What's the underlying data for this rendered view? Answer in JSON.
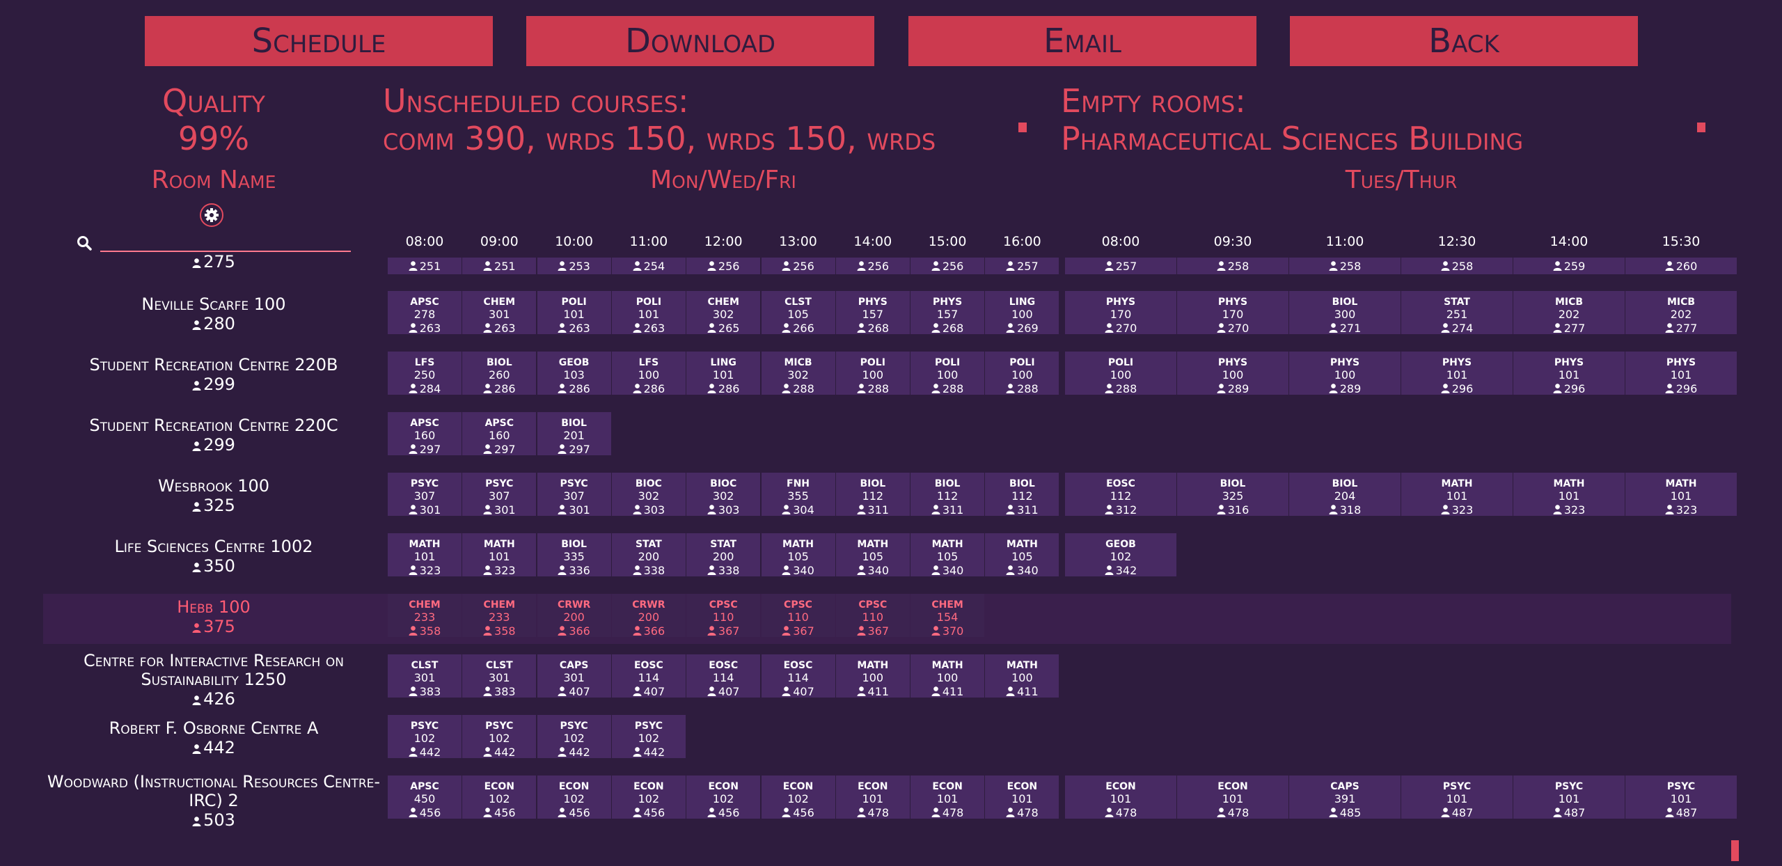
{
  "toolbar": {
    "schedule": "Schedule",
    "download": "Download",
    "email": "Email",
    "back": "Back"
  },
  "quality": {
    "title": "Quality",
    "value": "99%"
  },
  "room_name_label": "Room Name",
  "unscheduled": {
    "title": "Unscheduled courses:",
    "list": "comm 390, wrds 150, wrds 150, wrds"
  },
  "empty_rooms": {
    "title": "Empty rooms:",
    "list": "Pharmaceutical Sciences Building"
  },
  "mwf": {
    "label": "Mon/Wed/Fri",
    "times": [
      "08:00",
      "09:00",
      "10:00",
      "11:00",
      "12:00",
      "13:00",
      "14:00",
      "15:00",
      "16:00"
    ]
  },
  "tt": {
    "label": "Tues/Thur",
    "times": [
      "08:00",
      "09:30",
      "11:00",
      "12:30",
      "14:00",
      "15:30"
    ]
  },
  "search": {
    "placeholder": "",
    "value": ""
  },
  "colors": {
    "accent": "#e24a5e",
    "button": "#cc3a4f",
    "background": "#2e1c3e",
    "cell": "#482a63"
  },
  "icons": {
    "settings": "gear-icon",
    "search": "search-icon",
    "capacity": "person-icon"
  },
  "partial_row": {
    "capacity": "275",
    "mwf": [
      "251",
      "251",
      "253",
      "254",
      "256",
      "256",
      "256",
      "256",
      "257"
    ],
    "tt": [
      "257",
      "258",
      "258",
      "258",
      "259",
      "260"
    ]
  },
  "rooms": [
    {
      "name": "Neville Scarfe 100",
      "capacity": "280",
      "selected": false,
      "mwf": [
        [
          "APSC",
          "278",
          "263"
        ],
        [
          "CHEM",
          "301",
          "263"
        ],
        [
          "POLI",
          "101",
          "263"
        ],
        [
          "POLI",
          "101",
          "263"
        ],
        [
          "CHEM",
          "302",
          "265"
        ],
        [
          "CLST",
          "105",
          "266"
        ],
        [
          "PHYS",
          "157",
          "268"
        ],
        [
          "PHYS",
          "157",
          "268"
        ],
        [
          "LING",
          "100",
          "269"
        ]
      ],
      "tt": [
        [
          "PHYS",
          "170",
          "270"
        ],
        [
          "PHYS",
          "170",
          "270"
        ],
        [
          "BIOL",
          "300",
          "271"
        ],
        [
          "STAT",
          "251",
          "274"
        ],
        [
          "MICB",
          "202",
          "277"
        ],
        [
          "MICB",
          "202",
          "277"
        ]
      ]
    },
    {
      "name": "Student Recreation Centre 220B",
      "capacity": "299",
      "selected": false,
      "mwf": [
        [
          "LFS",
          "250",
          "284"
        ],
        [
          "BIOL",
          "260",
          "286"
        ],
        [
          "GEOB",
          "103",
          "286"
        ],
        [
          "LFS",
          "100",
          "286"
        ],
        [
          "LING",
          "101",
          "286"
        ],
        [
          "MICB",
          "302",
          "288"
        ],
        [
          "POLI",
          "100",
          "288"
        ],
        [
          "POLI",
          "100",
          "288"
        ],
        [
          "POLI",
          "100",
          "288"
        ]
      ],
      "tt": [
        [
          "POLI",
          "100",
          "288"
        ],
        [
          "PHYS",
          "100",
          "289"
        ],
        [
          "PHYS",
          "100",
          "289"
        ],
        [
          "PHYS",
          "101",
          "296"
        ],
        [
          "PHYS",
          "101",
          "296"
        ],
        [
          "PHYS",
          "101",
          "296"
        ]
      ]
    },
    {
      "name": "Student Recreation Centre 220C",
      "capacity": "299",
      "selected": false,
      "mwf": [
        [
          "APSC",
          "160",
          "297"
        ],
        [
          "APSC",
          "160",
          "297"
        ],
        [
          "BIOL",
          "201",
          "297"
        ]
      ],
      "tt": []
    },
    {
      "name": "Wesbrook 100",
      "capacity": "325",
      "selected": false,
      "mwf": [
        [
          "PSYC",
          "307",
          "301"
        ],
        [
          "PSYC",
          "307",
          "301"
        ],
        [
          "PSYC",
          "307",
          "301"
        ],
        [
          "BIOC",
          "302",
          "303"
        ],
        [
          "BIOC",
          "302",
          "303"
        ],
        [
          "FNH",
          "355",
          "304"
        ],
        [
          "BIOL",
          "112",
          "311"
        ],
        [
          "BIOL",
          "112",
          "311"
        ],
        [
          "BIOL",
          "112",
          "311"
        ]
      ],
      "tt": [
        [
          "EOSC",
          "112",
          "312"
        ],
        [
          "BIOL",
          "325",
          "316"
        ],
        [
          "BIOL",
          "204",
          "318"
        ],
        [
          "MATH",
          "101",
          "323"
        ],
        [
          "MATH",
          "101",
          "323"
        ],
        [
          "MATH",
          "101",
          "323"
        ]
      ]
    },
    {
      "name": "Life Sciences Centre 1002",
      "capacity": "350",
      "selected": false,
      "mwf": [
        [
          "MATH",
          "101",
          "323"
        ],
        [
          "MATH",
          "101",
          "323"
        ],
        [
          "BIOL",
          "335",
          "336"
        ],
        [
          "STAT",
          "200",
          "338"
        ],
        [
          "STAT",
          "200",
          "338"
        ],
        [
          "MATH",
          "105",
          "340"
        ],
        [
          "MATH",
          "105",
          "340"
        ],
        [
          "MATH",
          "105",
          "340"
        ],
        [
          "MATH",
          "105",
          "340"
        ]
      ],
      "tt": [
        [
          "GEOB",
          "102",
          "342"
        ]
      ]
    },
    {
      "name": "Hebb 100",
      "capacity": "375",
      "selected": true,
      "mwf": [
        [
          "CHEM",
          "233",
          "358"
        ],
        [
          "CHEM",
          "233",
          "358"
        ],
        [
          "CRWR",
          "200",
          "366"
        ],
        [
          "CRWR",
          "200",
          "366"
        ],
        [
          "CPSC",
          "110",
          "367"
        ],
        [
          "CPSC",
          "110",
          "367"
        ],
        [
          "CPSC",
          "110",
          "367"
        ],
        [
          "CHEM",
          "154",
          "370"
        ]
      ],
      "tt": []
    },
    {
      "name": "Centre for Interactive Research on Sustainability 1250",
      "capacity": "426",
      "selected": false,
      "mwf": [
        [
          "CLST",
          "301",
          "383"
        ],
        [
          "CLST",
          "301",
          "383"
        ],
        [
          "CAPS",
          "301",
          "407"
        ],
        [
          "EOSC",
          "114",
          "407"
        ],
        [
          "EOSC",
          "114",
          "407"
        ],
        [
          "EOSC",
          "114",
          "407"
        ],
        [
          "MATH",
          "100",
          "411"
        ],
        [
          "MATH",
          "100",
          "411"
        ],
        [
          "MATH",
          "100",
          "411"
        ]
      ],
      "tt": []
    },
    {
      "name": "Robert F. Osborne Centre A",
      "capacity": "442",
      "selected": false,
      "mwf": [
        [
          "PSYC",
          "102",
          "442"
        ],
        [
          "PSYC",
          "102",
          "442"
        ],
        [
          "PSYC",
          "102",
          "442"
        ],
        [
          "PSYC",
          "102",
          "442"
        ]
      ],
      "tt": []
    },
    {
      "name": "Woodward (Instructional Resources Centre-IRC) 2",
      "capacity": "503",
      "selected": false,
      "mwf": [
        [
          "APSC",
          "450",
          "456"
        ],
        [
          "ECON",
          "102",
          "456"
        ],
        [
          "ECON",
          "102",
          "456"
        ],
        [
          "ECON",
          "102",
          "456"
        ],
        [
          "ECON",
          "102",
          "456"
        ],
        [
          "ECON",
          "102",
          "456"
        ],
        [
          "ECON",
          "101",
          "478"
        ],
        [
          "ECON",
          "101",
          "478"
        ],
        [
          "ECON",
          "101",
          "478"
        ]
      ],
      "tt": [
        [
          "ECON",
          "101",
          "478"
        ],
        [
          "ECON",
          "101",
          "478"
        ],
        [
          "CAPS",
          "391",
          "485"
        ],
        [
          "PSYC",
          "101",
          "487"
        ],
        [
          "PSYC",
          "101",
          "487"
        ],
        [
          "PSYC",
          "101",
          "487"
        ]
      ]
    }
  ]
}
